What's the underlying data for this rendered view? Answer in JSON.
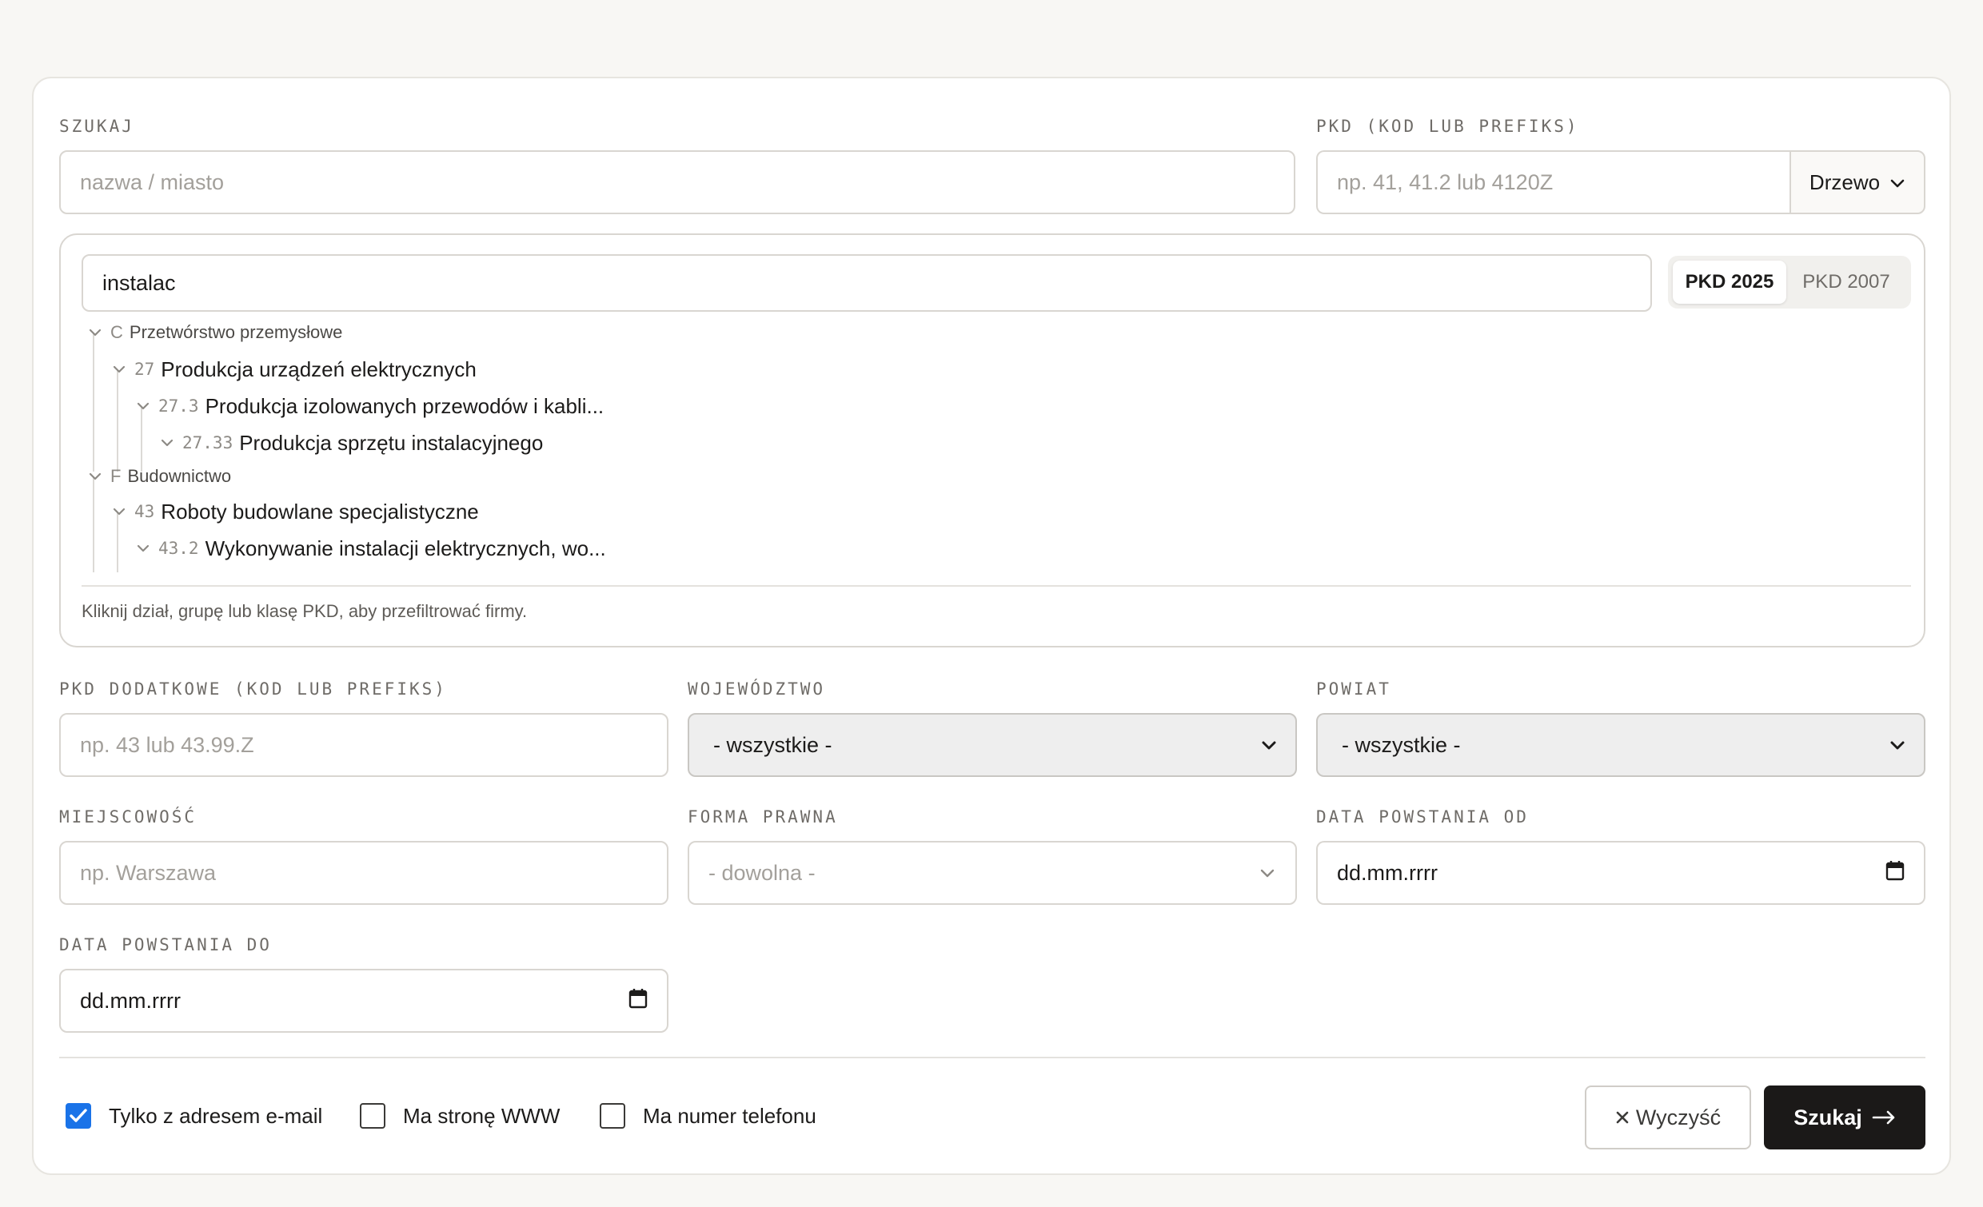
{
  "search": {
    "label": "SZUKAJ",
    "placeholder": "nazwa / miasto"
  },
  "pkd": {
    "label": "PKD (KOD LUB PREFIKS)",
    "placeholder": "np. 41, 41.2 lub 4120Z",
    "mode": "Drzewo"
  },
  "tree": {
    "query": "instalac",
    "versions": [
      "PKD 2025",
      "PKD 2007"
    ],
    "active_version": "PKD 2025",
    "nodes": [
      {
        "code": "C",
        "name": "Przetwórstwo przemysłowe"
      },
      {
        "code": "27",
        "name": "Produkcja urządzeń elektrycznych"
      },
      {
        "code": "27.3",
        "name": "Produkcja izolowanych przewodów i kabli..."
      },
      {
        "code": "27.33",
        "name": "Produkcja sprzętu instalacyjnego"
      },
      {
        "code": "F",
        "name": "Budownictwo"
      },
      {
        "code": "43",
        "name": "Roboty budowlane specjalistyczne"
      },
      {
        "code": "43.2",
        "name": "Wykonywanie instalacji elektrycznych, wo..."
      }
    ],
    "hint": "Kliknij dział, grupę lub klasę PKD, aby przefiltrować firmy."
  },
  "pkd_extra": {
    "label": "PKD DODATKOWE (KOD LUB PREFIKS)",
    "placeholder": "np. 43 lub 43.99.Z"
  },
  "voivodeship": {
    "label": "WOJEWÓDZTWO",
    "value": "- wszystkie -"
  },
  "county": {
    "label": "POWIAT",
    "value": "- wszystkie -"
  },
  "city": {
    "label": "MIEJSCOWOŚĆ",
    "placeholder": "np. Warszawa"
  },
  "legal_form": {
    "label": "FORMA PRAWNA",
    "value": "- dowolna -"
  },
  "date_from": {
    "label": "DATA POWSTANIA OD",
    "value": "dd.mm.rrrr"
  },
  "date_to": {
    "label": "DATA POWSTANIA DO",
    "value": "dd.mm.rrrr"
  },
  "filters": {
    "email": {
      "label": "Tylko z adresem e-mail",
      "checked": true
    },
    "www": {
      "label": "Ma stronę WWW",
      "checked": false
    },
    "phone": {
      "label": "Ma numer telefonu",
      "checked": false
    }
  },
  "actions": {
    "clear": "Wyczyść",
    "submit": "Szukaj"
  },
  "colors": {
    "accent": "#1a73e8",
    "primary_button": "#1b1918",
    "background": "#f8f7f4"
  },
  "icons": [
    "chevron-down-icon",
    "calendar-icon",
    "close-icon",
    "arrow-right-icon",
    "check-icon"
  ]
}
